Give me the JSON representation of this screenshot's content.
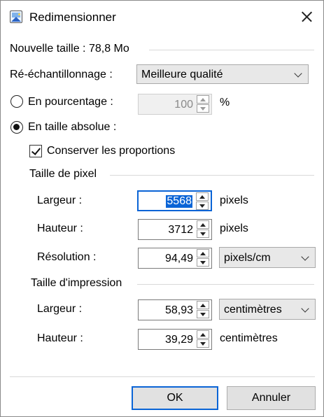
{
  "window": {
    "title": "Redimensionner",
    "icon": "image-resize-icon",
    "close_icon": "close-icon"
  },
  "new_size": {
    "label": "Nouvelle taille : 78,8 Mo"
  },
  "resampling": {
    "label": "Ré-échantillonnage :",
    "value": "Meilleure qualité"
  },
  "percentage": {
    "label": "En pourcentage :",
    "selected": false,
    "value": "100",
    "unit": "%"
  },
  "absolute": {
    "label": "En taille absolue :",
    "selected": true
  },
  "keep_proportions": {
    "label": "Conserver les proportions",
    "checked": true
  },
  "pixel_size": {
    "heading": "Taille de pixel",
    "width_label": "Largeur :",
    "width_value": "5568",
    "width_unit": "pixels",
    "height_label": "Hauteur :",
    "height_value": "3712",
    "height_unit": "pixels",
    "resolution_label": "Résolution :",
    "resolution_value": "94,49",
    "resolution_unit": "pixels/cm"
  },
  "print_size": {
    "heading": "Taille d'impression",
    "width_label": "Largeur :",
    "width_value": "58,93",
    "width_unit": "centimètres",
    "height_label": "Hauteur :",
    "height_value": "39,29",
    "height_unit": "centimètres"
  },
  "buttons": {
    "ok": "OK",
    "cancel": "Annuler"
  },
  "colors": {
    "accent": "#0a64d6",
    "button_bg": "#e1e1e1",
    "dropdown_bg": "#e8e8e8"
  }
}
